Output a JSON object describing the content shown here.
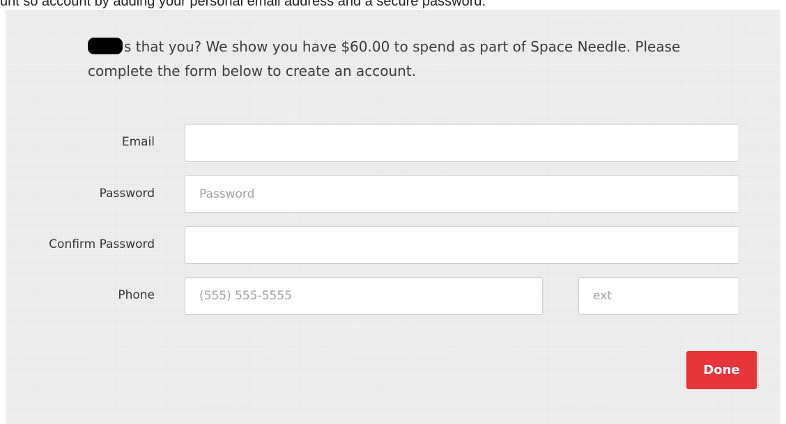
{
  "top_caption": "unt so account by adding your personal email address and a secure password.",
  "intro": {
    "text": "s that you? We show you have $60.00 to spend as part of Space Needle. Please complete the form below to create an account."
  },
  "form": {
    "email_label": "Email",
    "email_value": "",
    "password_label": "Password",
    "password_placeholder": "Password",
    "confirm_label": "Confirm Password",
    "confirm_value": "",
    "phone_label": "Phone",
    "phone_placeholder": "(555) 555-5555",
    "ext_placeholder": "ext"
  },
  "done_label": "Done",
  "colors": {
    "done_button": "#e8343b",
    "panel_background": "#ebebeb"
  }
}
